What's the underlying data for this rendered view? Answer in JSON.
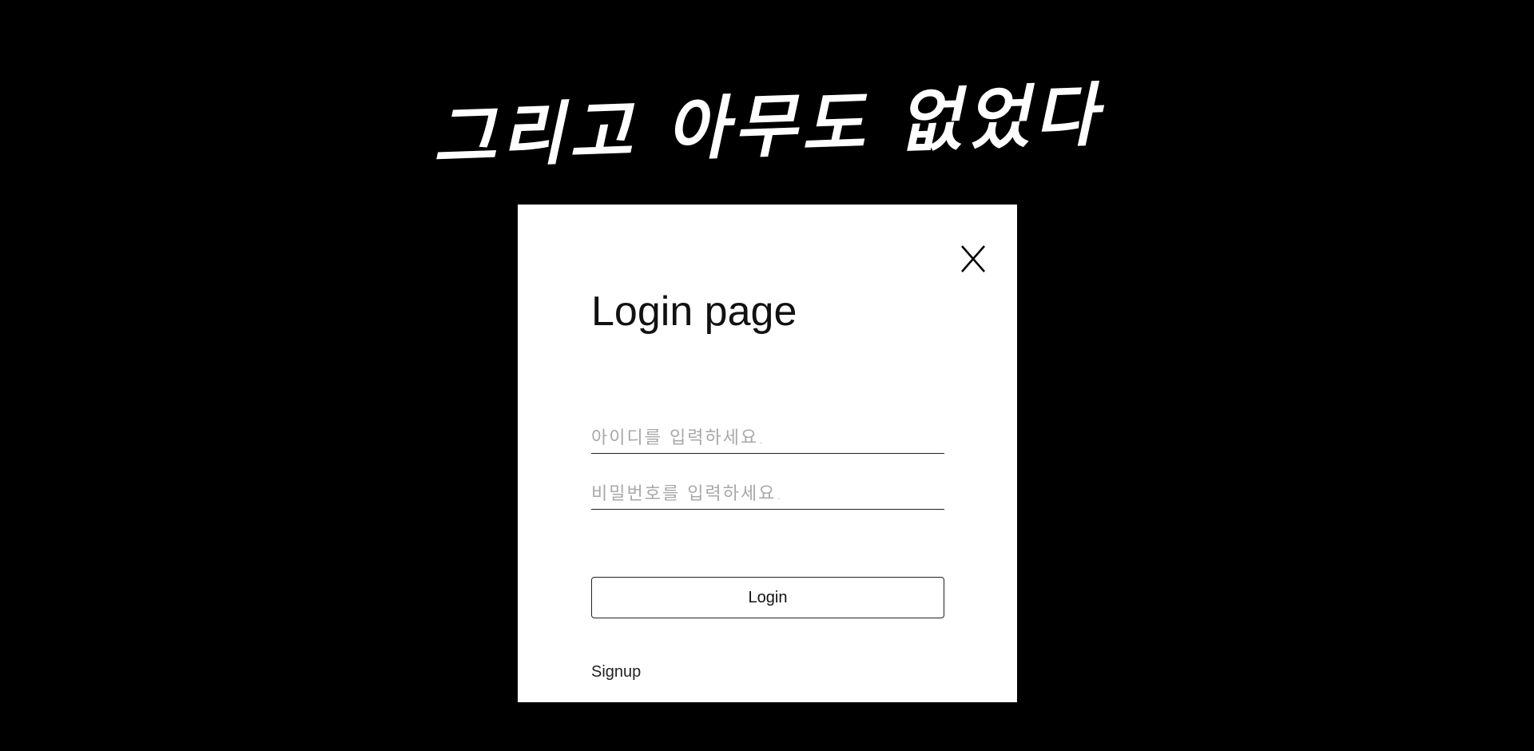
{
  "brand": {
    "title": "그리고 아무도 없었다"
  },
  "modal": {
    "close_icon": "close-icon",
    "title": "Login page",
    "id_placeholder": "아이디를 입력하세요.",
    "password_placeholder": "비밀번호를 입력하세요.",
    "login_label": "Login",
    "signup_label": "Signup"
  },
  "colors": {
    "background": "#000000",
    "modal": "#ffffff",
    "placeholder": "#a8a8a8"
  }
}
